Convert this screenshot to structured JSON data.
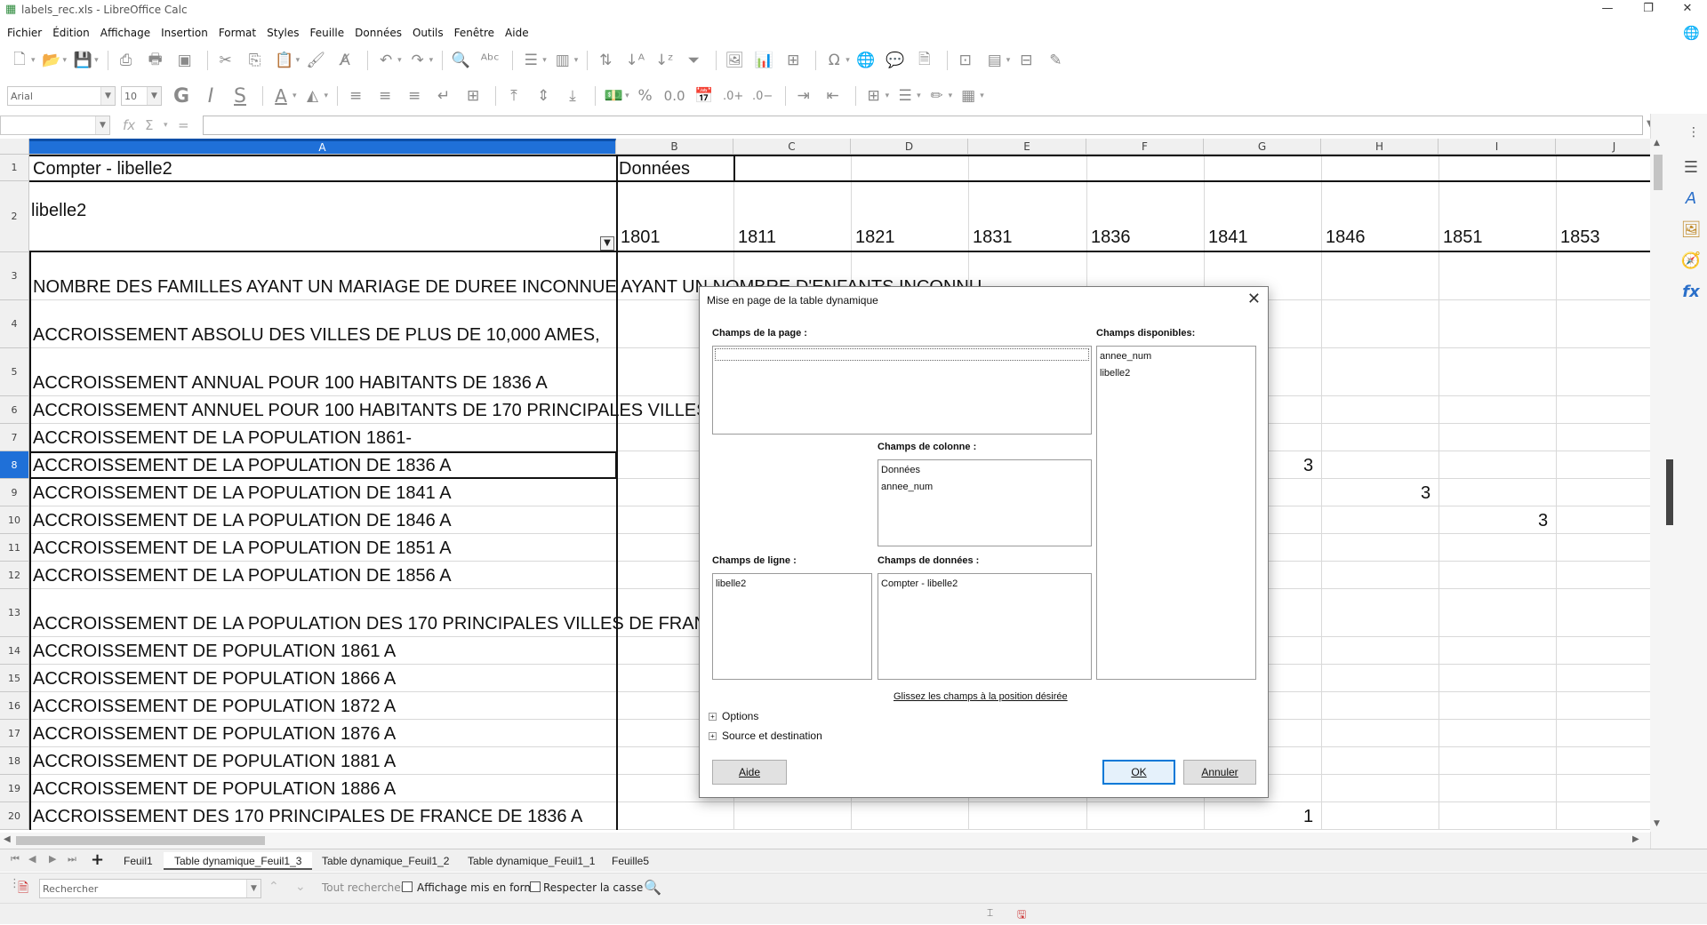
{
  "window": {
    "title": "labels_rec.xls - LibreOffice Calc"
  },
  "menu": [
    "Fichier",
    "Édition",
    "Affichage",
    "Insertion",
    "Format",
    "Styles",
    "Feuille",
    "Données",
    "Outils",
    "Fenêtre",
    "Aide"
  ],
  "toolbar2": {
    "font_name": "Arial",
    "font_size": "10"
  },
  "columns": [
    "A",
    "B",
    "C",
    "D",
    "E",
    "F",
    "G",
    "H",
    "I",
    "J"
  ],
  "pivot": {
    "a1": "Compter - libelle2",
    "b1": "Données",
    "a2": "libelle2",
    "years": [
      "1801",
      "1811",
      "1821",
      "1831",
      "1836",
      "1841",
      "1846",
      "1851",
      "1853"
    ]
  },
  "rows": [
    {
      "num": "1"
    },
    {
      "num": "2"
    },
    {
      "num": "3",
      "label": " NOMBRE DES FAMILLES AYANT UN MARIAGE DE DUREE INCONNUE AYANT UN NOMBRE D'ENFANTS INCONNU"
    },
    {
      "num": "4",
      "label": "ACCROISSEMENT ABSOLU DES VILLES DE PLUS DE 10,000 AMES,"
    },
    {
      "num": "5",
      "label": "ACCROISSEMENT ANNUAL POUR 100 HABITANTS DE 1836 A"
    },
    {
      "num": "6",
      "label": "ACCROISSEMENT ANNUEL POUR 100 HABITANTS DE 170 PRINCIPALES VILLES"
    },
    {
      "num": "7",
      "label": "ACCROISSEMENT DE LA POPULATION 1861-"
    },
    {
      "num": "8",
      "label": "ACCROISSEMENT DE LA POPULATION DE 1836 A",
      "value": "3",
      "value_col": "G"
    },
    {
      "num": "9",
      "label": "ACCROISSEMENT DE LA POPULATION DE 1841 A",
      "value": "3",
      "value_col": "H"
    },
    {
      "num": "10",
      "label": "ACCROISSEMENT DE LA POPULATION DE 1846 A",
      "value": "3",
      "value_col": "I"
    },
    {
      "num": "11",
      "label": "ACCROISSEMENT DE LA POPULATION DE 1851 A"
    },
    {
      "num": "12",
      "label": "ACCROISSEMENT DE LA POPULATION DE 1856 A"
    },
    {
      "num": "13",
      "label": "ACCROISSEMENT DE LA POPULATION DES 170 PRINCIPALES VILLES DE FRANCE"
    },
    {
      "num": "14",
      "label": "ACCROISSEMENT DE POPULATION 1861 A"
    },
    {
      "num": "15",
      "label": "ACCROISSEMENT DE POPULATION 1866 A"
    },
    {
      "num": "16",
      "label": "ACCROISSEMENT DE POPULATION 1872 A"
    },
    {
      "num": "17",
      "label": "ACCROISSEMENT DE POPULATION 1876 A"
    },
    {
      "num": "18",
      "label": "ACCROISSEMENT DE POPULATION 1881 A"
    },
    {
      "num": "19",
      "label": "ACCROISSEMENT DE POPULATION 1886 A"
    },
    {
      "num": "20",
      "label": "ACCROISSEMENT DES 170 PRINCIPALES DE FRANCE DE 1836 A",
      "value": "1",
      "value_col": "G"
    }
  ],
  "sheet_tabs": [
    "Feuil1",
    "Table dynamique_Feuil1_3",
    "Table dynamique_Feuil1_2",
    "Table dynamique_Feuil1_1",
    "Feuille5"
  ],
  "active_sheet": "Table dynamique_Feuil1_3",
  "findbar": {
    "placeholder": "Rechercher",
    "find_all": "Tout rechercher",
    "formatted_display": "Affichage mis en forme",
    "match_case": "Respecter la casse"
  },
  "dialog": {
    "title": "Mise en page de la table dynamique",
    "page_fields_label": "Champs de la page :",
    "available_fields_label": "Champs disponibles:",
    "available_fields": [
      "annee_num",
      "libelle2"
    ],
    "column_fields_label": "Champs de colonne :",
    "column_fields": [
      "Données",
      "annee_num"
    ],
    "row_fields_label": "Champs de ligne :",
    "row_fields": [
      "libelle2"
    ],
    "data_fields_label": "Champs de données :",
    "data_fields": [
      "Compter - libelle2"
    ],
    "drag_hint": "Glissez les champs à la position désirée",
    "options": "Options",
    "source_dest": "Source et destination",
    "help_btn": "Aide",
    "ok_btn": "OK",
    "cancel_btn": "Annuler"
  }
}
